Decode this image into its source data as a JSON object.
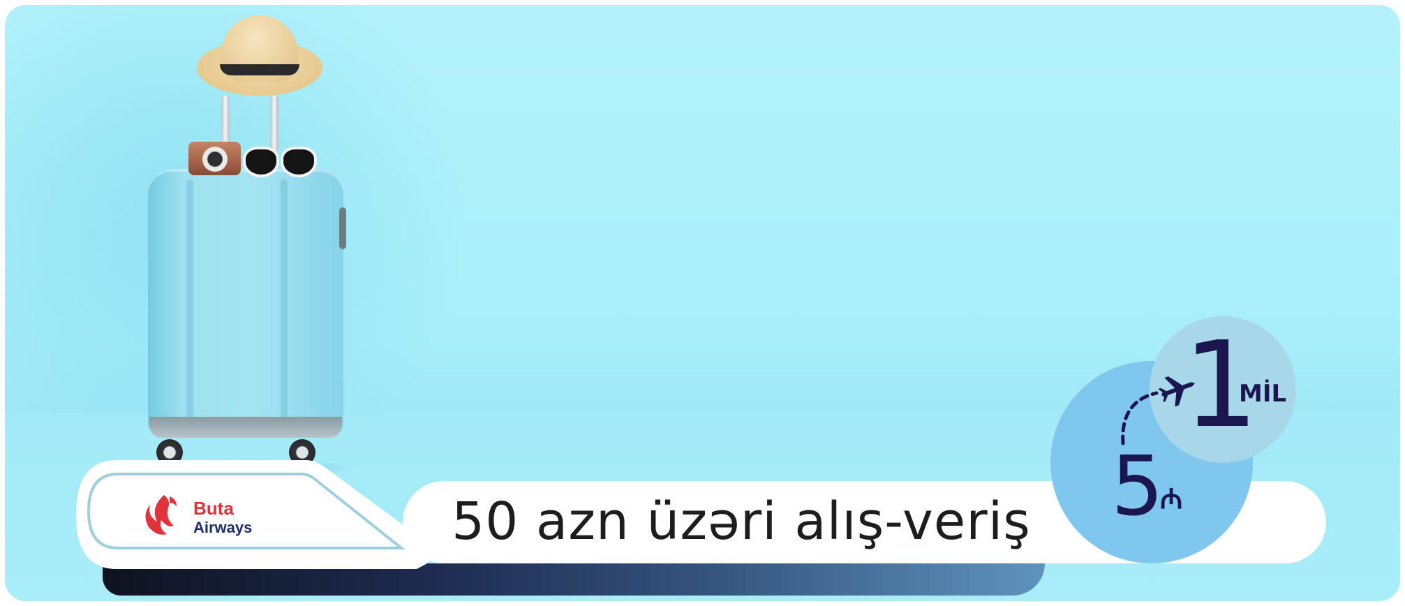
{
  "banner": {
    "title": "50 azn üzəri alış-veriş",
    "brand": {
      "logo_text_line1": "Buta",
      "logo_text_line2": "Airways",
      "logo_icon": "buta-bird-logo-icon"
    },
    "offer": {
      "miles_value": "1",
      "miles_unit": "MİL",
      "spend_value": "5",
      "currency_symbol": "₼",
      "plane_icon": "airplane-icon"
    },
    "illustration": "suitcase-with-hat-camera-sunglasses",
    "colors": {
      "background": "#a8eefa",
      "accent_dark": "#1b1650",
      "brand_red": "#e2333d",
      "brand_navy": "#1d2d6b",
      "badge_big": "#7fc7ee",
      "badge_small": "#a8d7ea"
    }
  }
}
